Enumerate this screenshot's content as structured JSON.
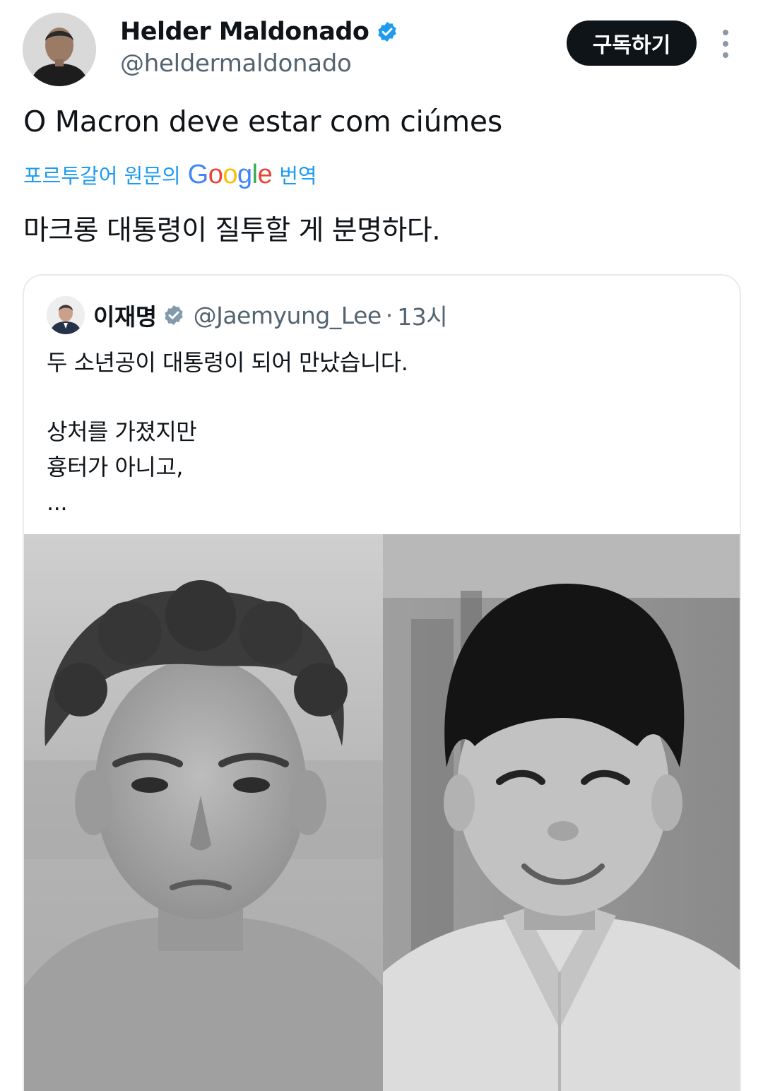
{
  "author": {
    "name": "Helder Maldonado",
    "handle": "@heldermaldonado"
  },
  "actions": {
    "subscribe_label": "구독하기",
    "more_icon": "more-vertical-icon"
  },
  "tweet": {
    "text": "O Macron deve estar com ciúmes",
    "translation_prefix": "포르투갈어 원문의",
    "google_logo": "Google",
    "translation_suffix": "번역",
    "translated_text": "마크롱 대통령이 질투할 게 분명하다."
  },
  "quote": {
    "name": "이재명",
    "handle": "@Jaemyung_Lee",
    "separator": "·",
    "time": "13시",
    "lines": [
      "두 소년공이 대통령이 되어 만났습니다.",
      "상처를 가졌지만",
      "흉터가 아니고,",
      "..."
    ]
  },
  "colors": {
    "accent": "#1d9bf0",
    "verified_blue": "#1d9bf0",
    "verified_gray": "#829aab",
    "text_primary": "#0f1419",
    "text_secondary": "#536471"
  }
}
